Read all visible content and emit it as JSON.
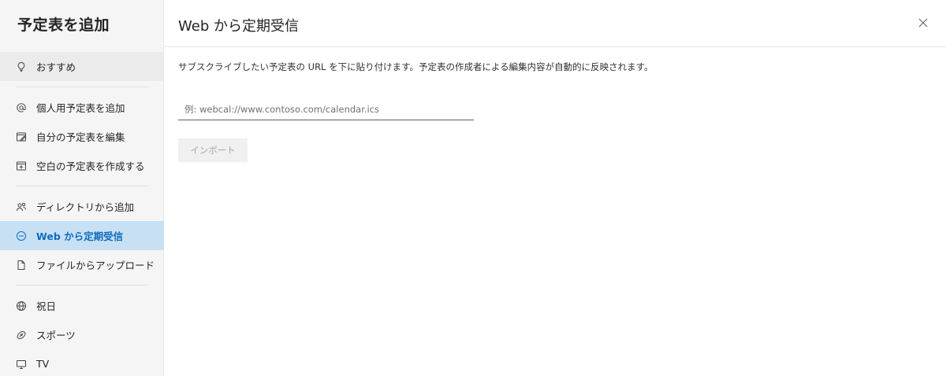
{
  "sidebar": {
    "title": "予定表を追加",
    "items": [
      {
        "label": "おすすめ",
        "icon": "lightbulb-icon"
      },
      {
        "label": "個人用予定表を追加",
        "icon": "at-sign-icon"
      },
      {
        "label": "自分の予定表を編集",
        "icon": "calendar-edit-icon"
      },
      {
        "label": "空白の予定表を作成する",
        "icon": "calendar-add-icon"
      },
      {
        "label": "ディレクトリから追加",
        "icon": "people-search-icon"
      },
      {
        "label": "Web から定期受信",
        "icon": "subscribe-icon"
      },
      {
        "label": "ファイルからアップロード",
        "icon": "document-upload-icon"
      },
      {
        "label": "祝日",
        "icon": "globe-icon"
      },
      {
        "label": "スポーツ",
        "icon": "sports-ball-icon"
      },
      {
        "label": "TV",
        "icon": "tv-icon"
      }
    ],
    "selected": "Web から定期受信"
  },
  "main": {
    "title": "Web から定期受信",
    "description": "サブスクライブしたい予定表の URL を下に貼り付けます。予定表の作成者による編集内容が自動的に反映されます。",
    "url_input": {
      "placeholder": "例: webcal://www.contoso.com/calendar.ics",
      "value": ""
    },
    "import_label": "インポート",
    "close_icon": "close-icon"
  },
  "colors": {
    "sidebar_bg": "#f5f5f5",
    "selected_bg": "#c7e0f4",
    "accent": "#0f6cbd",
    "disabled_button_bg": "#f0f0f0"
  }
}
